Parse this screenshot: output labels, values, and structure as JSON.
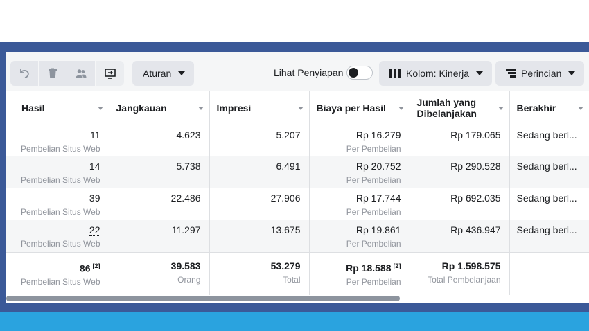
{
  "toolbar": {
    "icons": [
      "undo-icon",
      "trash-icon",
      "people-icon",
      "export-icon"
    ],
    "rules_label": "Aturan",
    "preview_label": "Lihat Penyiapan",
    "preview_toggle_on": false,
    "columns_label": "Kolom: Kinerja",
    "breakdown_label": "Perincian"
  },
  "table": {
    "headers": [
      "Hasil",
      "Jangkauan",
      "Impresi",
      "Biaya per Hasil",
      "Jumlah yang Dibelanjakan",
      "Berakhir"
    ],
    "rows": [
      {
        "hasil": "11",
        "hasil_sub": "Pembelian Situs Web",
        "jangkauan": "4.623",
        "impresi": "5.207",
        "biaya": "Rp 16.279",
        "biaya_sub": "Per Pembelian",
        "jumlah": "Rp 179.065",
        "berakhir": "Sedang berl..."
      },
      {
        "hasil": "14",
        "hasil_sub": "Pembelian Situs Web",
        "jangkauan": "5.738",
        "impresi": "6.491",
        "biaya": "Rp 20.752",
        "biaya_sub": "Per Pembelian",
        "jumlah": "Rp 290.528",
        "berakhir": "Sedang berl..."
      },
      {
        "hasil": "39",
        "hasil_sub": "Pembelian Situs Web",
        "jangkauan": "22.486",
        "impresi": "27.906",
        "biaya": "Rp 17.744",
        "biaya_sub": "Per Pembelian",
        "jumlah": "Rp 692.035",
        "berakhir": "Sedang berl..."
      },
      {
        "hasil": "22",
        "hasil_sub": "Pembelian Situs Web",
        "jangkauan": "11.297",
        "impresi": "13.675",
        "biaya": "Rp 19.861",
        "biaya_sub": "Per Pembelian",
        "jumlah": "Rp 436.947",
        "berakhir": "Sedang berl..."
      }
    ],
    "total": {
      "hasil": "86",
      "hasil_note": "[2]",
      "hasil_sub": "Pembelian Situs Web",
      "jangkauan": "39.583",
      "jangkauan_sub": "Orang",
      "impresi": "53.279",
      "impresi_sub": "Total",
      "biaya": "Rp 18.588",
      "biaya_note": "[2]",
      "biaya_sub": "Per Pembelian",
      "jumlah": "Rp 1.598.575",
      "jumlah_sub": "Total Pembelanjaan"
    }
  },
  "colors": {
    "frame": "#3b5998",
    "bottom_bar": "#2aa3df",
    "row_alt": "#f5f6f7"
  }
}
